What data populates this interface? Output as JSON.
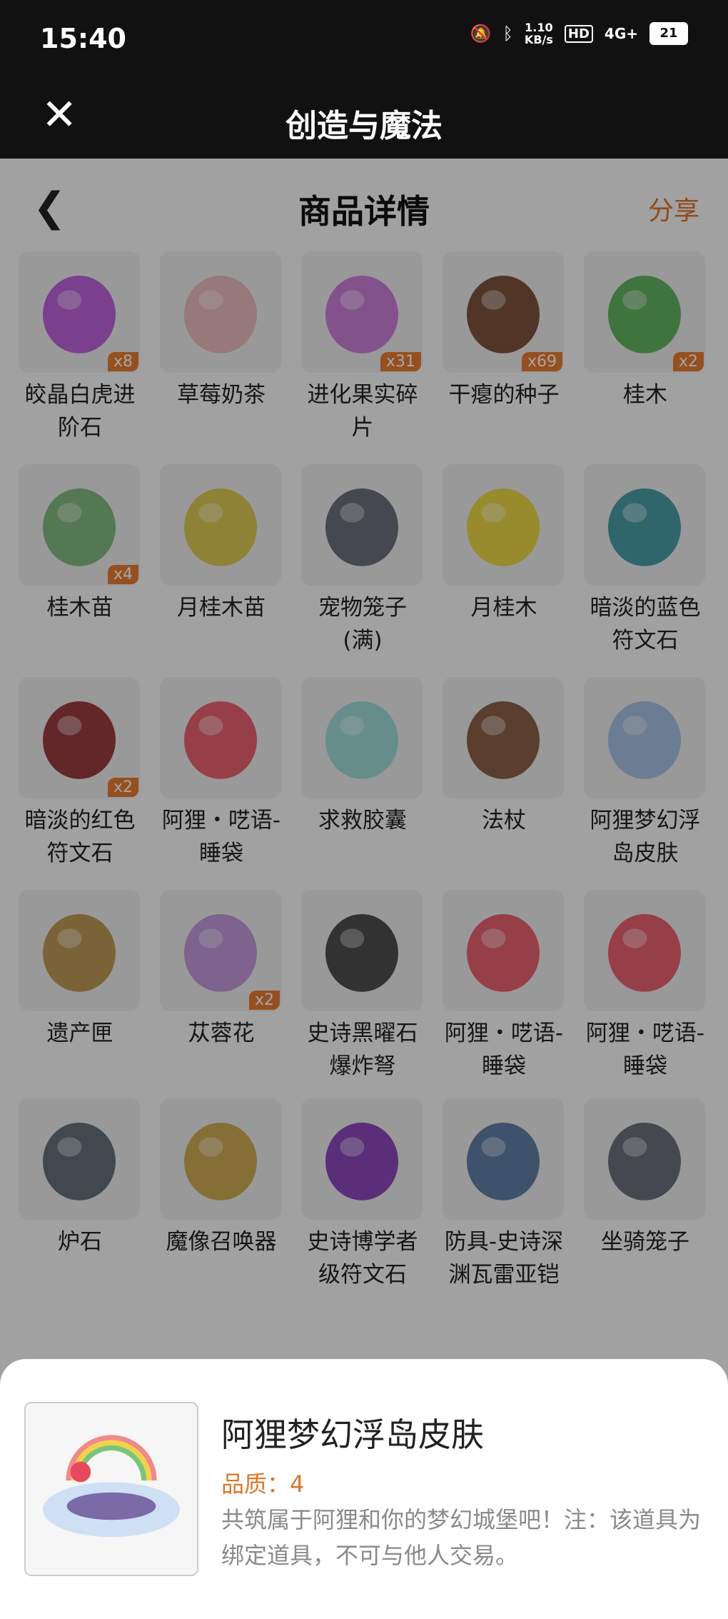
{
  "status": {
    "time": "15:40",
    "net_speed_top": "1.10",
    "net_speed_unit": "KB/s",
    "hd": "HD",
    "signal": "4G+",
    "battery": "21"
  },
  "app": {
    "title": "创造与魔法",
    "close_icon": "close-icon"
  },
  "header": {
    "title": "商品详情",
    "share": "分享",
    "back_icon": "chevron-left-icon"
  },
  "items": [
    {
      "label": "皎晶白虎进阶石",
      "badge": "x8",
      "icon": "purple-gem",
      "color": "#b54bd6"
    },
    {
      "label": "草莓奶茶",
      "badge": "",
      "icon": "milk-tea",
      "color": "#e9b0b6"
    },
    {
      "label": "进化果实碎片",
      "badge": "x31",
      "icon": "fruit-slice",
      "color": "#c46bd6"
    },
    {
      "label": "干瘪的种子",
      "badge": "x69",
      "icon": "seed",
      "color": "#6a3a1e"
    },
    {
      "label": "桂木",
      "badge": "x2",
      "icon": "green-tree",
      "color": "#4aa84a"
    },
    {
      "label": "桂木苗",
      "badge": "x4",
      "icon": "seed-pack-green",
      "color": "#6fb06f"
    },
    {
      "label": "月桂木苗",
      "badge": "",
      "icon": "seed-pack-yellow",
      "color": "#d8c23a"
    },
    {
      "label": "宠物笼子(满)",
      "badge": "",
      "icon": "pet-cage",
      "color": "#555a66"
    },
    {
      "label": "月桂木",
      "badge": "",
      "icon": "yellow-tree",
      "color": "#e8d22c"
    },
    {
      "label": "暗淡的蓝色符文石",
      "badge": "",
      "icon": "blue-rune",
      "color": "#2c8f99"
    },
    {
      "label": "暗淡的红色符文石",
      "badge": "x2",
      "icon": "red-rune",
      "color": "#8a1e22"
    },
    {
      "label": "阿狸・呓语-睡袋",
      "badge": "",
      "icon": "ahri-bag",
      "color": "#e84a5c"
    },
    {
      "label": "求救胶囊",
      "badge": "",
      "icon": "capsule-ring",
      "color": "#8fd6d0"
    },
    {
      "label": "法杖",
      "badge": "",
      "icon": "staff",
      "color": "#7a4a2a"
    },
    {
      "label": "阿狸梦幻浮岛皮肤",
      "badge": "",
      "icon": "floating-island",
      "color": "#9bb8e0"
    },
    {
      "label": "遗产匣",
      "badge": "",
      "icon": "chest",
      "color": "#b58a3c"
    },
    {
      "label": "苁蓉花",
      "badge": "x2",
      "icon": "flower",
      "color": "#b88ad6"
    },
    {
      "label": "史诗黑曜石爆炸弩",
      "badge": "",
      "icon": "crossbow",
      "color": "#333"
    },
    {
      "label": "阿狸・呓语-睡袋",
      "badge": "",
      "icon": "ahri-bag",
      "color": "#e84a5c"
    },
    {
      "label": "阿狸・呓语-睡袋",
      "badge": "",
      "icon": "ahri-bag",
      "color": "#e84a5c"
    },
    {
      "label": "炉石",
      "badge": "",
      "icon": "hearthstone",
      "color": "#4d5c66"
    },
    {
      "label": "魔像召唤器",
      "badge": "",
      "icon": "golem-summoner",
      "color": "#c9a03a"
    },
    {
      "label": "史诗博学者级符文石",
      "badge": "",
      "icon": "epic-rune",
      "color": "#7a2ab0"
    },
    {
      "label": "防具-史诗深渊瓦雷亚铠",
      "badge": "",
      "icon": "armor",
      "color": "#4a6c99"
    },
    {
      "label": "坐骑笼子",
      "badge": "",
      "icon": "mount-cage",
      "color": "#555a66"
    }
  ],
  "sheet": {
    "name": "阿狸梦幻浮岛皮肤",
    "quality": "品质：4",
    "description": "共筑属于阿狸和你的梦幻城堡吧！注：该道具为绑定道具，不可与他人交易。",
    "icon": "floating-island"
  }
}
